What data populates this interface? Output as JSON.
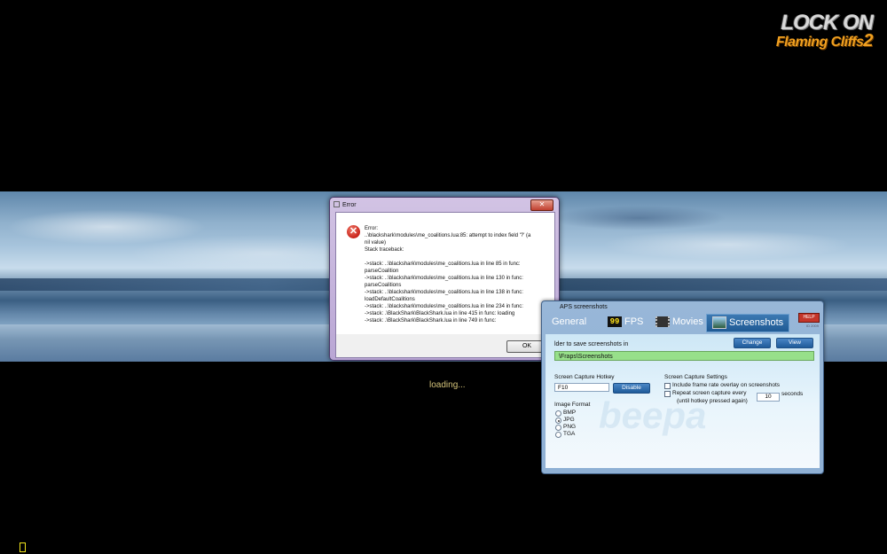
{
  "logo": {
    "line1": "LOCK ON",
    "line2": "Flaming Cliffs",
    "line2_num": "2"
  },
  "loading_text": "loading...",
  "error_dialog": {
    "title": "Error",
    "close_glyph": "✕",
    "icon_glyph": "✕",
    "lines": [
      "Error:",
      "..\\blackshark\\modules\\me_coalitions.lua:85: attempt to index field '?' (a",
      "nil value)",
      "Stack traceback:",
      "",
      "  ->stack: ..\\blackshark\\modules\\me_coalitions.lua in line 85 in func:",
      "parseCoalition",
      "  ->stack: ..\\blackshark\\modules\\me_coalitions.lua in line 130 in func:",
      "parseCoalitions",
      "  ->stack: ..\\blackshark\\modules\\me_coalitions.lua in line 138 in func:",
      "loadDefaultCoalitions",
      "  ->stack: ..\\blackshark\\modules\\me_coalitions.lua in line 234 in func:",
      "  ->stack: .\\BlackShark\\BlackShark.lua  in line 415 in func: loading",
      "  ->stack: .\\BlackShark\\BlackShark.lua  in line 749 in func:"
    ],
    "ok_label": "OK"
  },
  "fraps": {
    "title": "APS screenshots",
    "help_label": "HELP",
    "version": "ID 2009",
    "watermark": "beepa",
    "tabs": [
      {
        "label": "General"
      },
      {
        "label": "FPS",
        "icon_text": "99"
      },
      {
        "label": "Movies"
      },
      {
        "label": "Screenshots"
      }
    ],
    "folder_label": "lder to save screenshots in",
    "change_label": "Change",
    "view_label": "View",
    "folder_path": "\\Fraps\\Screenshots",
    "hotkey_label": "Screen Capture Hotkey",
    "hotkey_value": "F10",
    "disable_label": "Disable",
    "format_label": "Image Format",
    "formats": [
      {
        "label": "BMP",
        "selected": false
      },
      {
        "label": "JPG",
        "selected": true
      },
      {
        "label": "PNG",
        "selected": false
      },
      {
        "label": "TGA",
        "selected": false
      }
    ],
    "settings_label": "Screen Capture Settings",
    "opt_overlay": "Include frame rate overlay on screenshots",
    "opt_repeat": "Repeat screen capture every",
    "repeat_seconds": "10",
    "seconds_label": "seconds",
    "until_label": "(until hotkey pressed again)"
  }
}
